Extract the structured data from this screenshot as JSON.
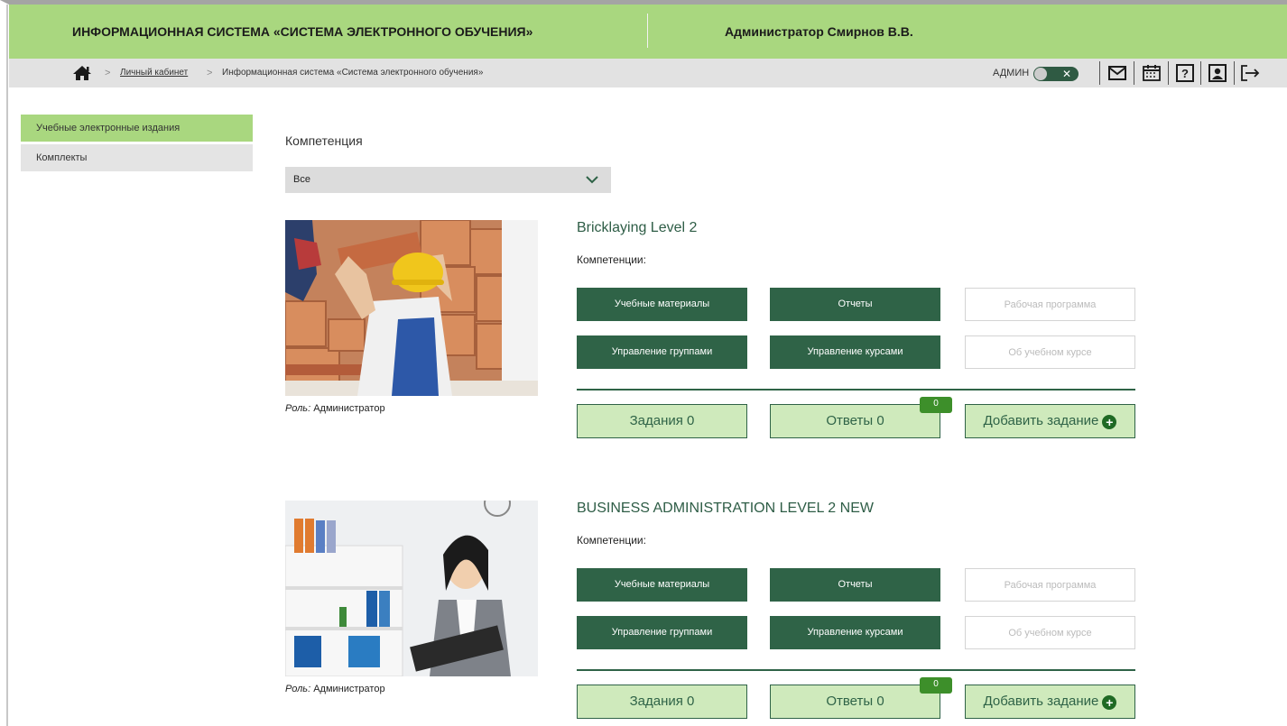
{
  "header": {
    "app_title": "ИНФОРМАЦИОННАЯ СИСТЕМА «СИСТЕМА ЭЛЕКТРОННОГО ОБУЧЕНИЯ»",
    "user_name": "Администратор Смирнов В.В."
  },
  "breadcrumb": {
    "separator": ">",
    "items": [
      "Личный кабинет",
      "Информационная система «Система электронного обучения»"
    ]
  },
  "toolbar": {
    "admin_label": "АДМИН",
    "toggle_mark": "✕",
    "icons": [
      "mail-icon",
      "calendar-icon",
      "help-icon",
      "profile-icon",
      "logout-icon"
    ]
  },
  "sidebar": {
    "items": [
      {
        "label": "Учебные электронные издания",
        "active": true
      },
      {
        "label": "Комплекты",
        "active": false
      }
    ]
  },
  "filter": {
    "label": "Компетенция",
    "selected": "Все"
  },
  "courses": [
    {
      "title": "Bricklaying Level 2",
      "competencies_label": "Компетенции:",
      "role_label": "Роль:",
      "role_value": "Администратор",
      "buttons": {
        "materials": "Учебные материалы",
        "reports": "Отчеты",
        "program": "Рабочая программа",
        "groups": "Управление группами",
        "courses": "Управление курсами",
        "about": "Об учебном курсе"
      },
      "tasks_label": "Задания 0",
      "answers_label": "Ответы 0",
      "answers_badge": "0",
      "add_task_label": "Добавить задание"
    },
    {
      "title": "BUSINESS ADMINISTRATION LEVEL 2 NEW",
      "competencies_label": "Компетенции:",
      "role_label": "Роль:",
      "role_value": "Администратор",
      "buttons": {
        "materials": "Учебные материалы",
        "reports": "Отчеты",
        "program": "Рабочая программа",
        "groups": "Управление группами",
        "courses": "Управление курсами",
        "about": "Об учебном курсе"
      },
      "tasks_label": "Задания 0",
      "answers_label": "Ответы 0",
      "answers_badge": "0",
      "add_task_label": "Добавить задание"
    }
  ],
  "colors": {
    "header_green": "#a9d77f",
    "dark_green": "#2f6347",
    "light_green": "#cfeabc",
    "badge_green": "#3d8f2a"
  }
}
